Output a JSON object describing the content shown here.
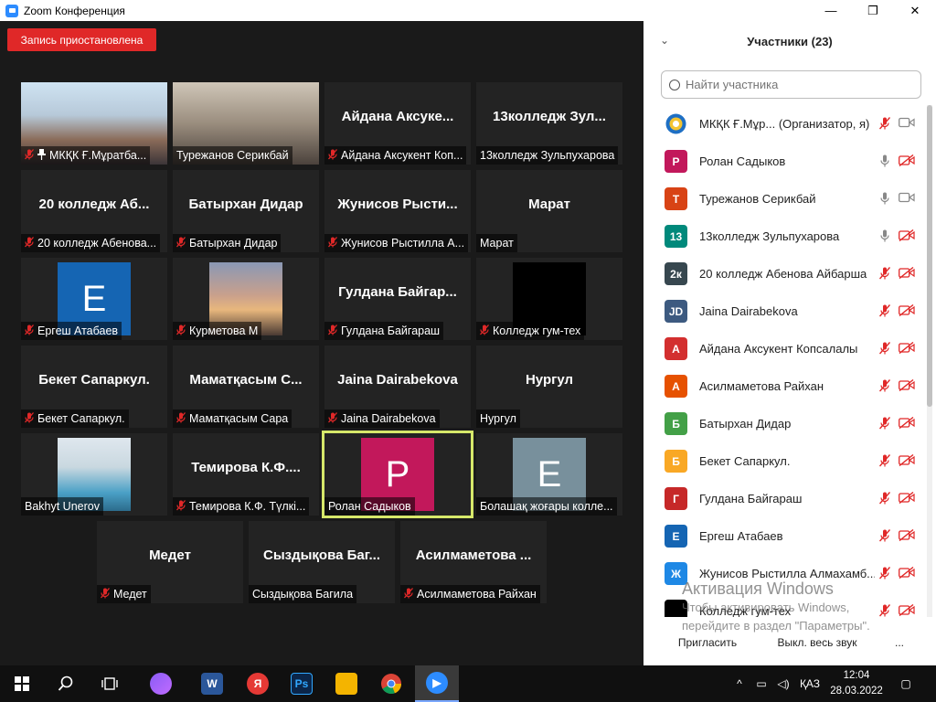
{
  "window": {
    "title": "Zoom Конференция",
    "minimize": "—",
    "maximize": "❐",
    "close": "✕"
  },
  "recording_badge": "Запись приостановлена",
  "tiles": [
    {
      "label": "МКҚК Ғ.Мұратба...",
      "pinned": true,
      "muted": true,
      "kind": "photo-classroom"
    },
    {
      "label": "Турежанов Серикбай",
      "muted": false,
      "kind": "photo-man"
    },
    {
      "center": "Айдана  Аксуке...",
      "label": "Айдана Аксукент Коп...",
      "muted": true
    },
    {
      "center": "13колледж  Зул...",
      "label": "13колледж Зульпухарова",
      "muted": false
    },
    {
      "center": "20  колледж  Аб...",
      "label": "20 колледж Абенова...",
      "muted": true
    },
    {
      "center": "Батырхан Дидар",
      "label": "Батырхан Дидар",
      "muted": true
    },
    {
      "center": "Жунисов  Рысти...",
      "label": "Жунисов Рыстилла А...",
      "muted": true
    },
    {
      "center": "Марат",
      "label": "Марат",
      "muted": false
    },
    {
      "avatar": "E",
      "avatar_color": "#1565b3",
      "label": "Ергеш Атабаев",
      "muted": true
    },
    {
      "label": "Курметова М",
      "muted": true,
      "kind": "photo-sunset"
    },
    {
      "center": "Гулдана  Байгар...",
      "label": "Гулдана Байгараш",
      "muted": true
    },
    {
      "label": "Колледж гум-тех",
      "muted": true,
      "kind": "photo-black"
    },
    {
      "center": "Бекет Сапаркул.",
      "label": "Бекет Сапаркул.",
      "muted": true
    },
    {
      "center": "Маматқасым  С...",
      "label": "Маматқасым Сара",
      "muted": true
    },
    {
      "center": "Jaina Dairabekova",
      "label": "Jaina Dairabekova",
      "muted": true
    },
    {
      "center": "Нургул",
      "label": "Нургул",
      "muted": false
    },
    {
      "label": "Bakhyt Unerov",
      "muted": false,
      "kind": "photo-person"
    },
    {
      "center": "Темирова  К.Ф....",
      "label": "Темирова К.Ф. Түлкі...",
      "muted": true
    },
    {
      "avatar": "P",
      "avatar_color": "#c2185b",
      "label": "Ролан Садыков",
      "muted": false,
      "active": true
    },
    {
      "avatar": "E",
      "avatar_color": "#78909c",
      "label": "Болашақ жоғары колле...",
      "muted": false
    },
    {
      "center": "Медет",
      "label": "Медет",
      "muted": true
    },
    {
      "center": "Сыздықова  Баг...",
      "label": "Сыздықова Багила",
      "muted": false
    },
    {
      "center": "Асилмаметова ...",
      "label": "Асилмаметова Райхан",
      "muted": true
    }
  ],
  "panel": {
    "title": "Участники (23)",
    "search_placeholder": "Найти участника",
    "participants": [
      {
        "initials": "",
        "color": "#ffffff",
        "name": "МКҚК Ғ.Мұр... (Организатор, я)",
        "mic": "muted",
        "cam": "on",
        "logo": true
      },
      {
        "initials": "P",
        "color": "#c2185b",
        "name": "Ролан Садыков",
        "mic": "on",
        "cam": "off"
      },
      {
        "initials": "T",
        "color": "#d84315",
        "name": "Турежанов Серикбай",
        "mic": "on",
        "cam": "on"
      },
      {
        "initials": "13",
        "color": "#00897b",
        "name": "13колледж Зульпухарова",
        "mic": "on",
        "cam": "off"
      },
      {
        "initials": "2к",
        "color": "#37474f",
        "name": "20 колледж Абенова Айбарша",
        "mic": "muted",
        "cam": "off"
      },
      {
        "initials": "JD",
        "color": "#3d5a80",
        "name": "Jaina Dairabekova",
        "mic": "muted",
        "cam": "off"
      },
      {
        "initials": "А",
        "color": "#d32f2f",
        "name": "Айдана Аксукент Копсалалы",
        "mic": "muted",
        "cam": "off"
      },
      {
        "initials": "А",
        "color": "#e65100",
        "name": "Асилмаметова Райхан",
        "mic": "muted",
        "cam": "off"
      },
      {
        "initials": "Б",
        "color": "#43a047",
        "name": "Батырхан Дидар",
        "mic": "muted",
        "cam": "off"
      },
      {
        "initials": "Б",
        "color": "#f9a825",
        "name": "Бекет Сапаркул.",
        "mic": "muted",
        "cam": "off"
      },
      {
        "initials": "Г",
        "color": "#c62828",
        "name": "Гулдана Байгараш",
        "mic": "muted",
        "cam": "off"
      },
      {
        "initials": "Е",
        "color": "#1565b3",
        "name": "Ергеш Атабаев",
        "mic": "muted",
        "cam": "off"
      },
      {
        "initials": "Ж",
        "color": "#1e88e5",
        "name": "Жунисов Рыстилла Алмахамб...",
        "mic": "muted",
        "cam": "off"
      },
      {
        "initials": "",
        "color": "#000000",
        "name": "Колледж гум-тех",
        "mic": "muted",
        "cam": "off"
      }
    ],
    "watermark_title": "Активация Windows",
    "watermark_line1": "Чтобы активировать Windows,",
    "watermark_line2": "перейдите в раздел \"Параметры\".",
    "invite": "Пригласить",
    "mute_all": "Выкл. весь звук",
    "more": "..."
  },
  "taskbar": {
    "lang": "ҚАЗ",
    "time": "12:04",
    "date": "28.03.2022"
  }
}
